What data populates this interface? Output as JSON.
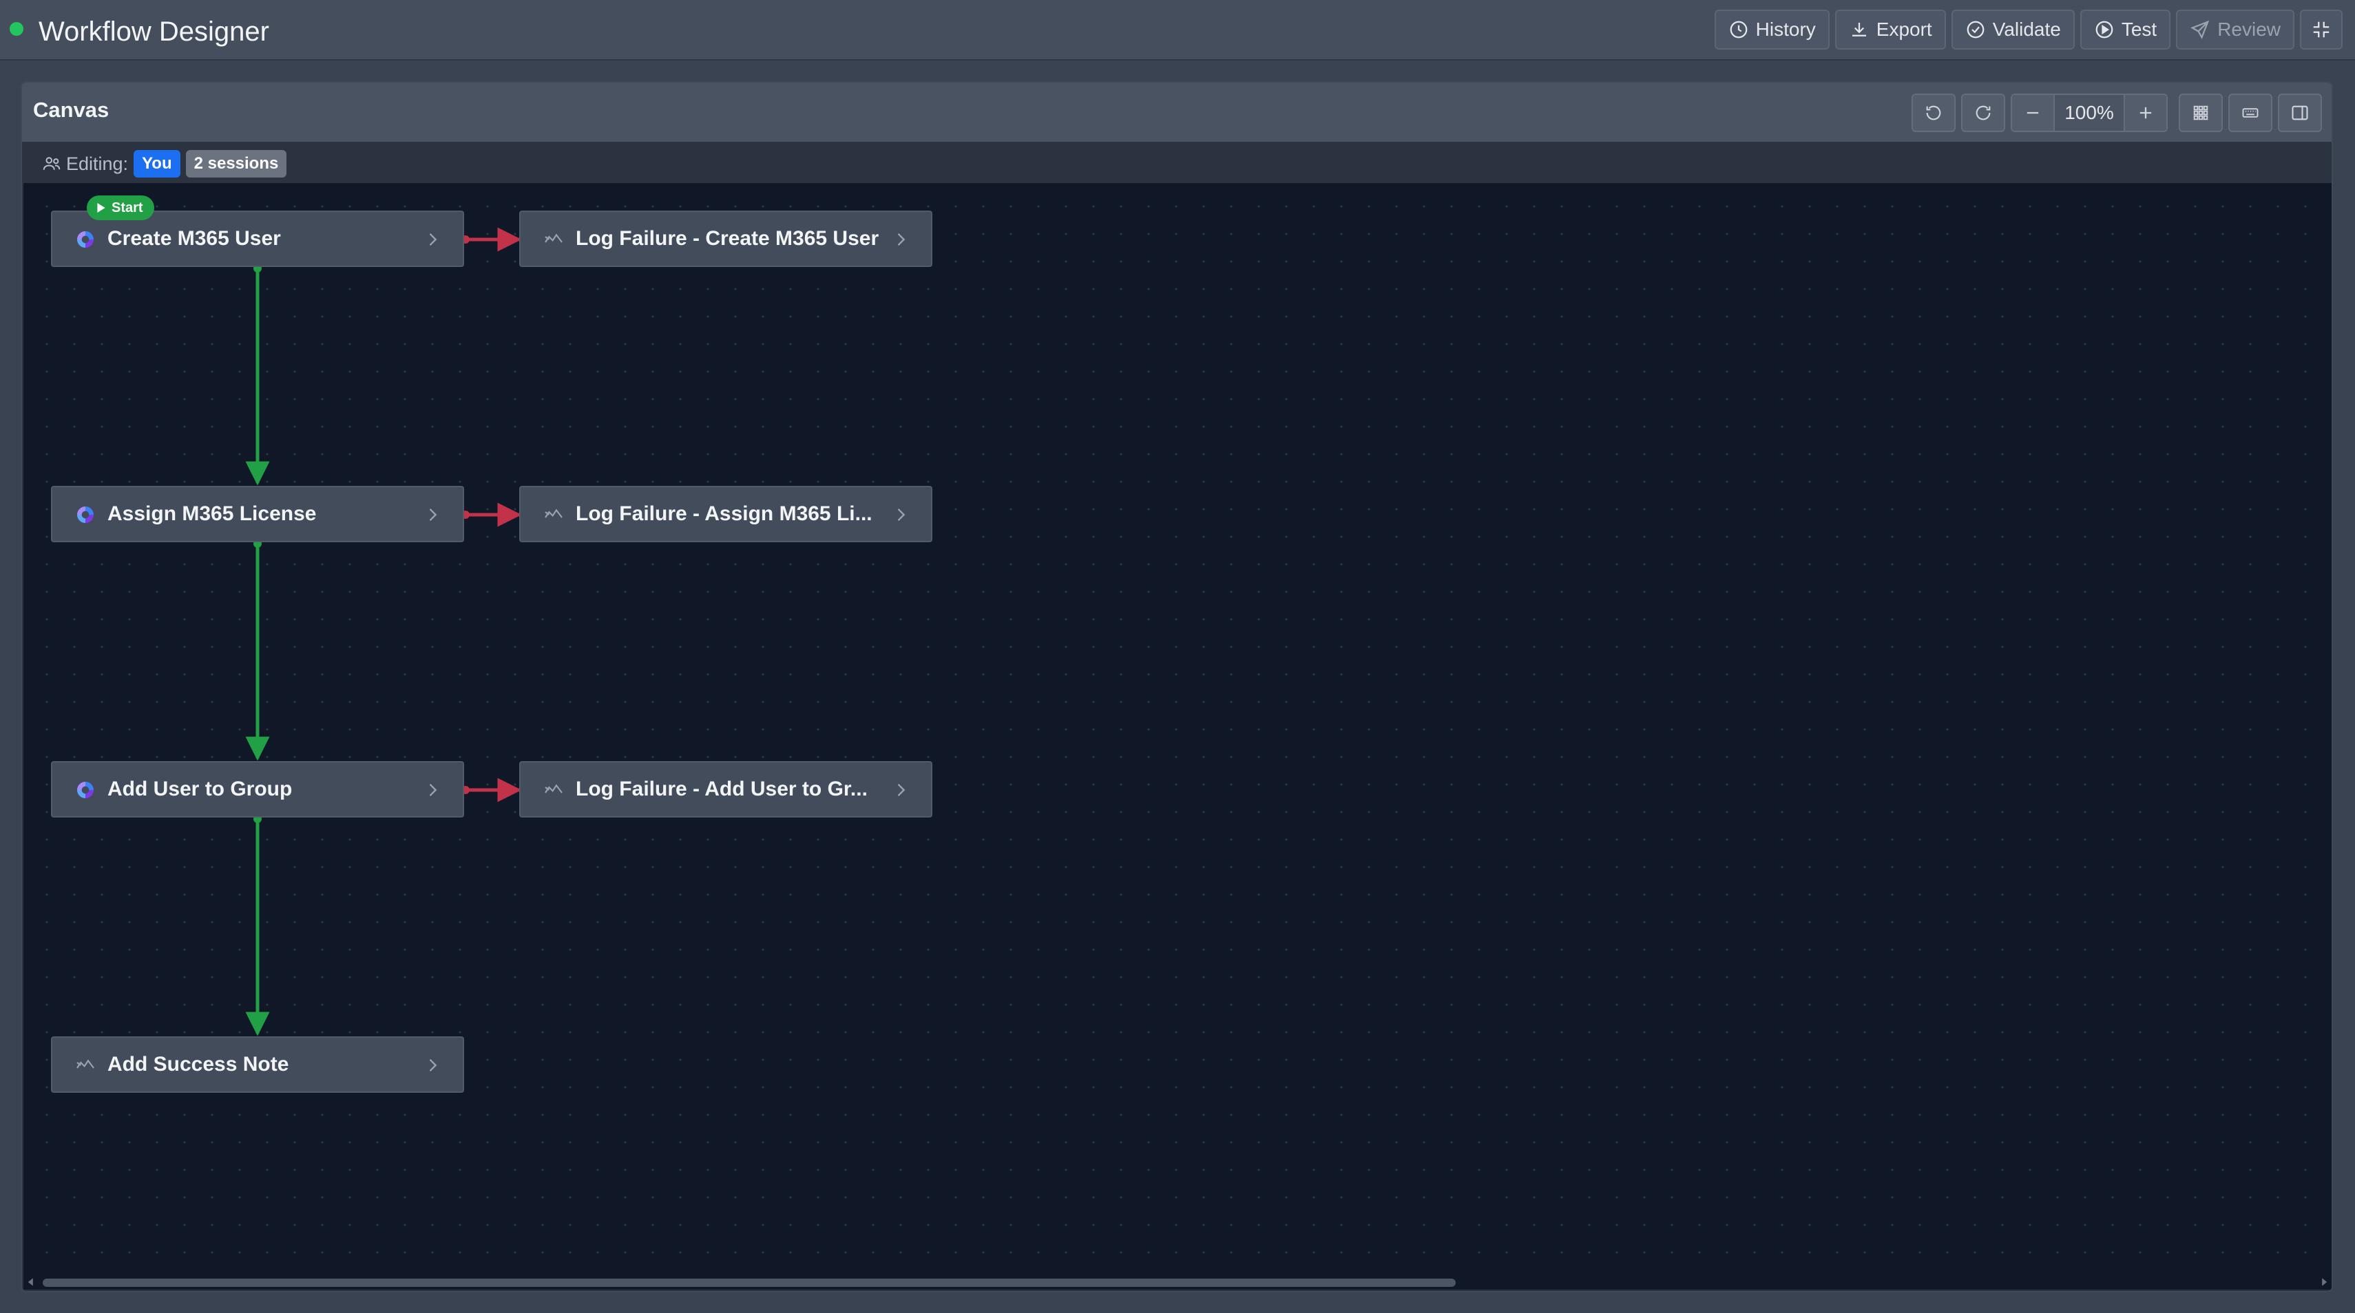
{
  "app": {
    "title": "Workflow Designer",
    "status_color": "#22c55e"
  },
  "toolbar": {
    "history_label": "History",
    "export_label": "Export",
    "validate_label": "Validate",
    "test_label": "Test",
    "review_label": "Review"
  },
  "canvas": {
    "title": "Canvas",
    "zoom": "100%",
    "editing_label": "Editing:",
    "editing_you": "You",
    "editing_sessions": "2 sessions"
  },
  "nodes": {
    "create_user": {
      "title": "Create M365 User",
      "icon": "m365-icon",
      "start": true
    },
    "log_create": {
      "title": "Log Failure - Create M365 User",
      "icon": "note-icon"
    },
    "assign_license": {
      "title": "Assign M365 License",
      "icon": "m365-icon"
    },
    "log_assign": {
      "title": "Log Failure - Assign M365 Li...",
      "icon": "note-icon"
    },
    "add_group": {
      "title": "Add User to Group",
      "icon": "m365-icon"
    },
    "log_group": {
      "title": "Log Failure - Add User to Gr...",
      "icon": "note-icon"
    },
    "success_note": {
      "title": "Add Success Note",
      "icon": "note-icon"
    }
  },
  "start_badge": "Start",
  "colors": {
    "success_edge": "#22a045",
    "failure_edge": "#c2334a",
    "accent": "#1d6ff2"
  }
}
